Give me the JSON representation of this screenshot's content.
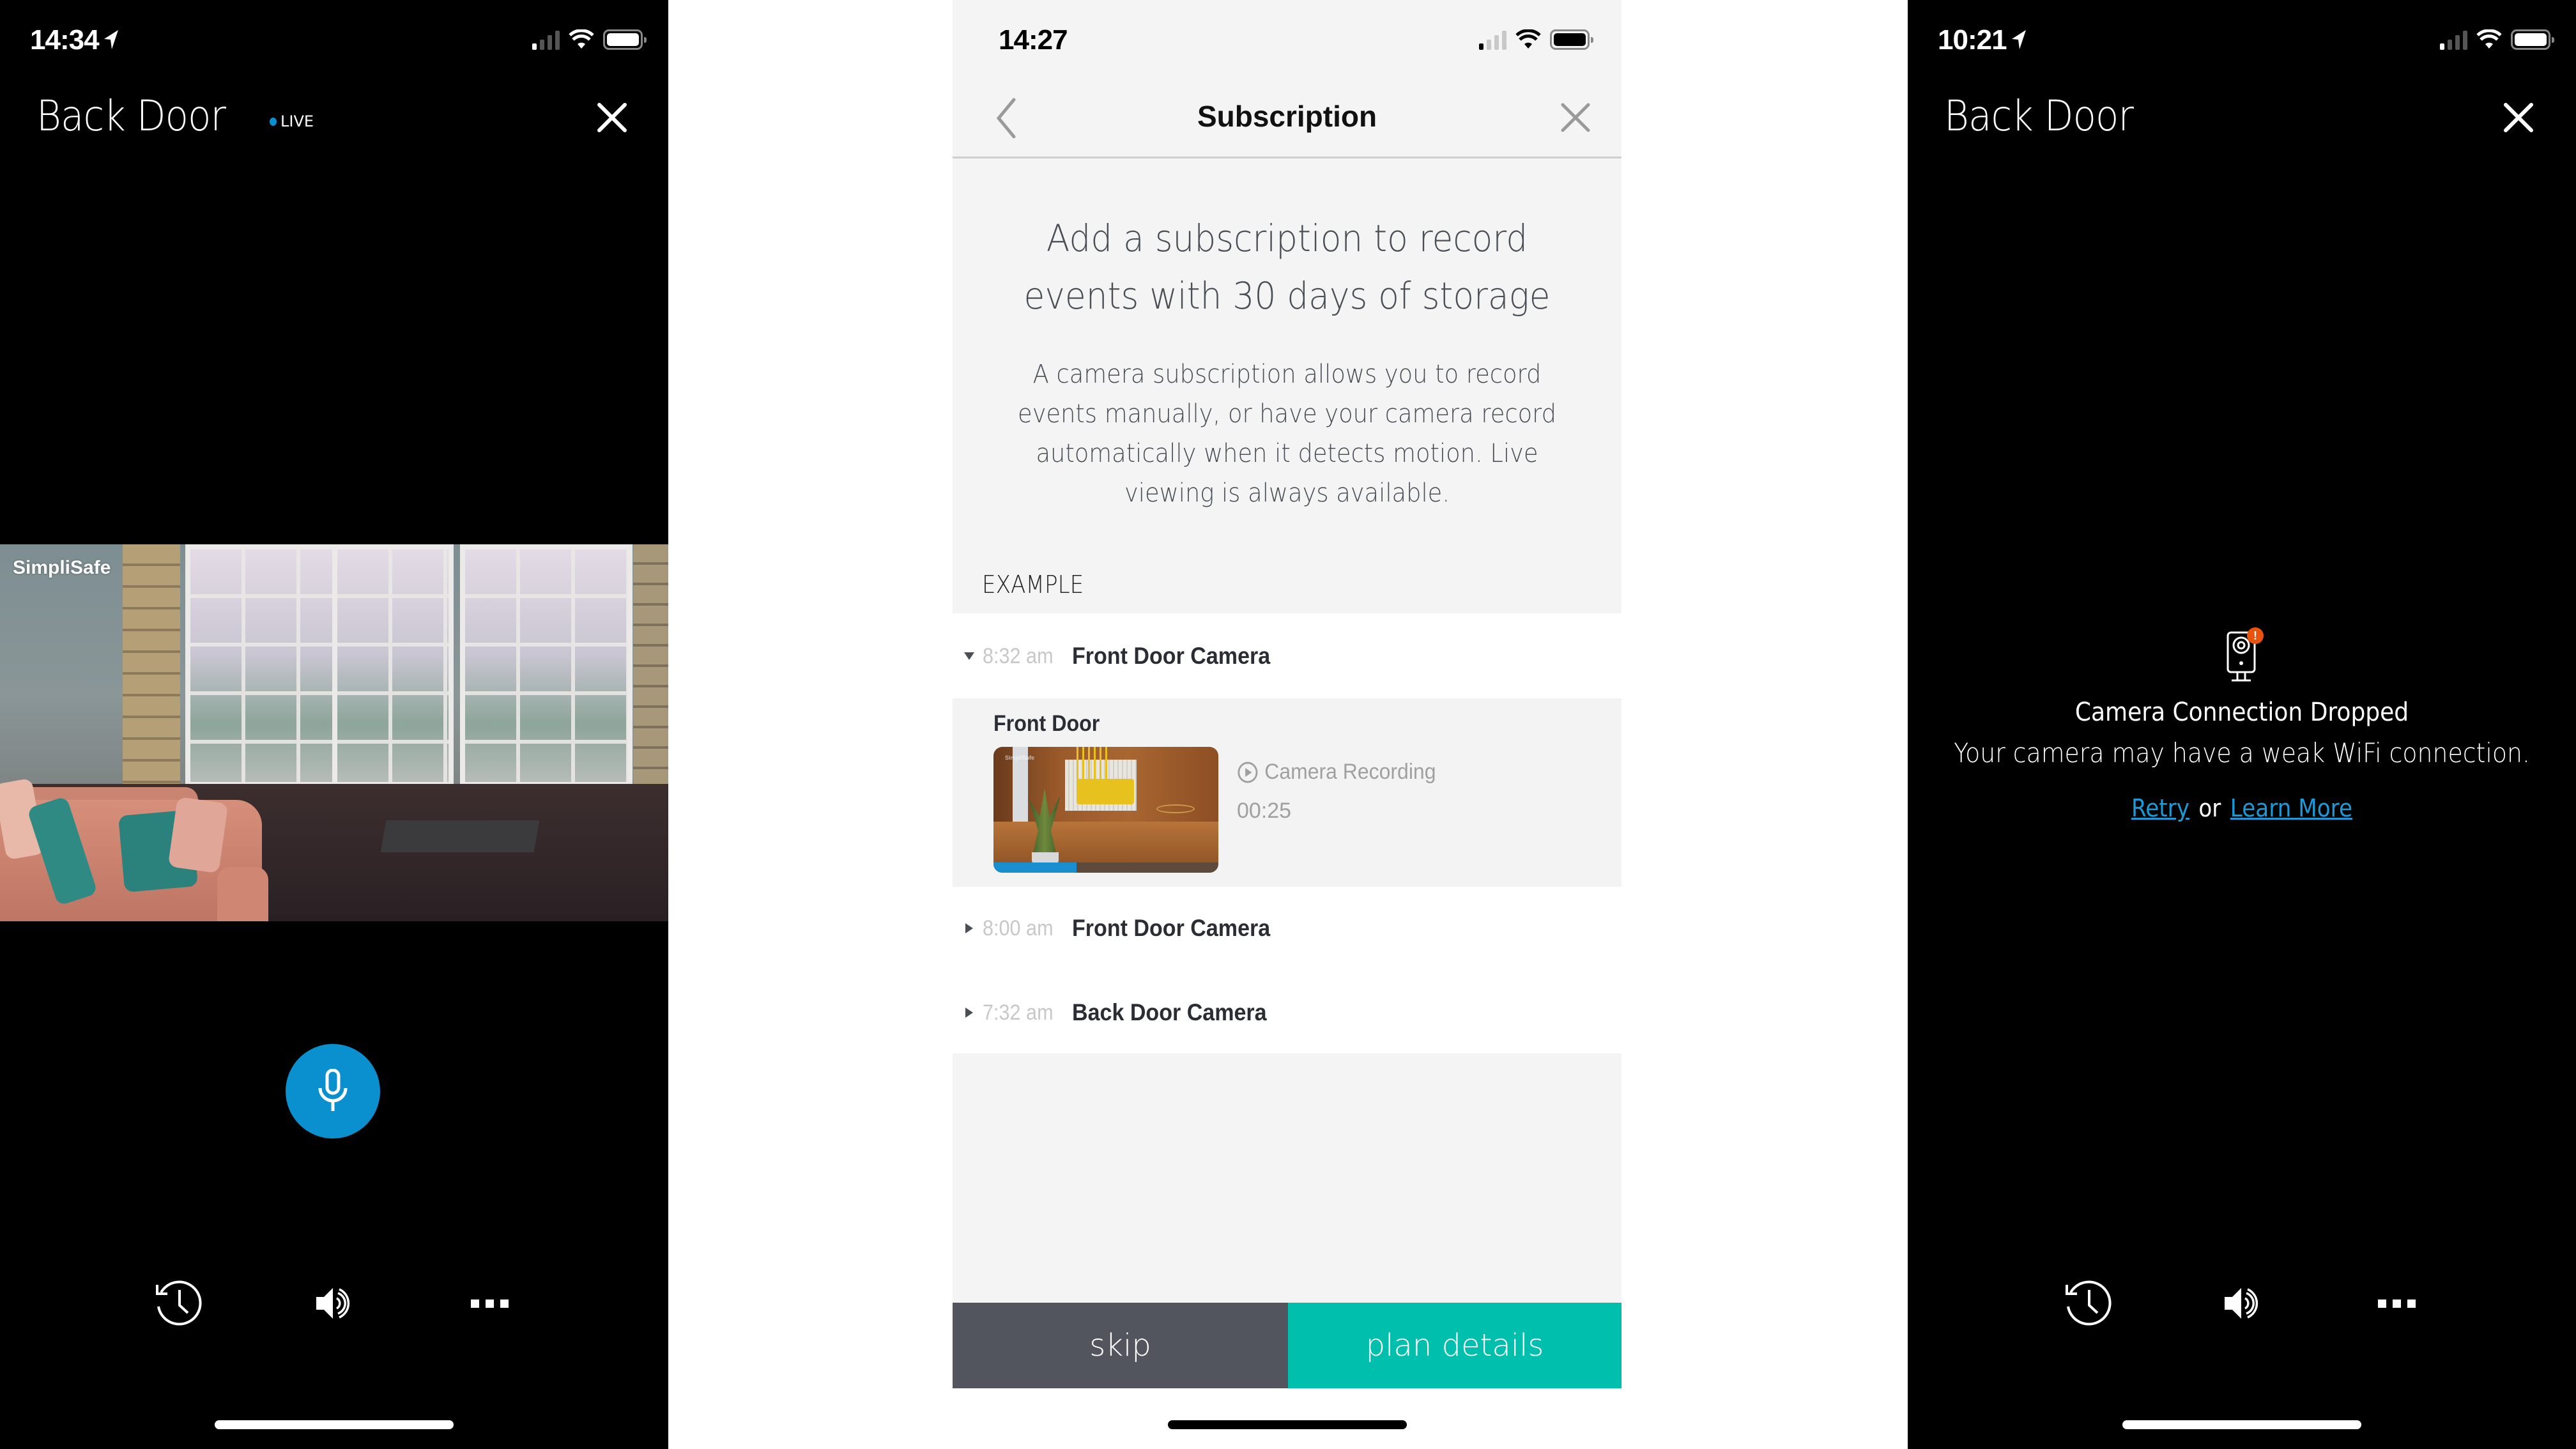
{
  "colors": {
    "accent_blue": "#0a8fcf",
    "teal": "#00bfac",
    "skip_gray": "#52555d",
    "alert_orange": "#e8530d",
    "link_blue": "#1a9ad9",
    "progress_blue": "#1a8fd0"
  },
  "left_screen": {
    "status": {
      "time": "14:34",
      "location_icon": "location-arrow-icon",
      "signal_bars_active": 1,
      "wifi_icon": "wifi-icon",
      "battery_icon": "battery-icon"
    },
    "title": "Back Door",
    "live_label": "LIVE",
    "close_icon": "close-icon",
    "video": {
      "watermark": "SimpliSafe"
    },
    "mic_icon": "microphone-icon",
    "controls": [
      {
        "name": "history",
        "icon": "history-clock-icon"
      },
      {
        "name": "audio",
        "icon": "speaker-icon"
      },
      {
        "name": "more",
        "icon": "more-dots-icon"
      }
    ]
  },
  "middle_screen": {
    "status": {
      "time": "14:27",
      "signal_bars_active": 1
    },
    "nav": {
      "title": "Subscription",
      "back_icon": "chevron-left-icon",
      "close_icon": "close-icon"
    },
    "promo": {
      "heading_lines": [
        "Add a subscription to record",
        "events with 30 days of storage"
      ],
      "body_lines": [
        "A camera subscription allows you to record",
        "events manually, or have your camera record",
        "automatically when it detects motion. Live",
        "viewing is always available."
      ]
    },
    "section_label": "EXAMPLE",
    "events": [
      {
        "time": "8:32 am",
        "name": "Front Door Camera",
        "expanded": true
      },
      {
        "time": "8:00 am",
        "name": "Front Door Camera",
        "expanded": false
      },
      {
        "time": "7:32 am",
        "name": "Back Door Camera",
        "expanded": false
      }
    ],
    "event_card": {
      "title": "Front Door",
      "thumbnail_watermark": "SimpliSafe",
      "recording_label": "Camera Recording",
      "play_icon": "play-circle-icon",
      "duration": "00:25",
      "progress_fraction": 0.37
    },
    "buttons": {
      "skip": "skip",
      "plan_details": "plan details"
    }
  },
  "right_screen": {
    "status": {
      "time": "10:21",
      "signal_bars_active": 1
    },
    "title": "Back Door",
    "close_icon": "close-icon",
    "error": {
      "icon": "camera-alert-icon",
      "badge": "!",
      "title": "Camera Connection Dropped",
      "message": "Your camera may have a weak WiFi connection.",
      "retry_label": "Retry",
      "or_label": "or",
      "learn_more_label": "Learn More"
    },
    "controls": [
      {
        "name": "history",
        "icon": "history-clock-icon"
      },
      {
        "name": "audio",
        "icon": "speaker-icon"
      },
      {
        "name": "more",
        "icon": "more-dots-icon"
      }
    ]
  }
}
